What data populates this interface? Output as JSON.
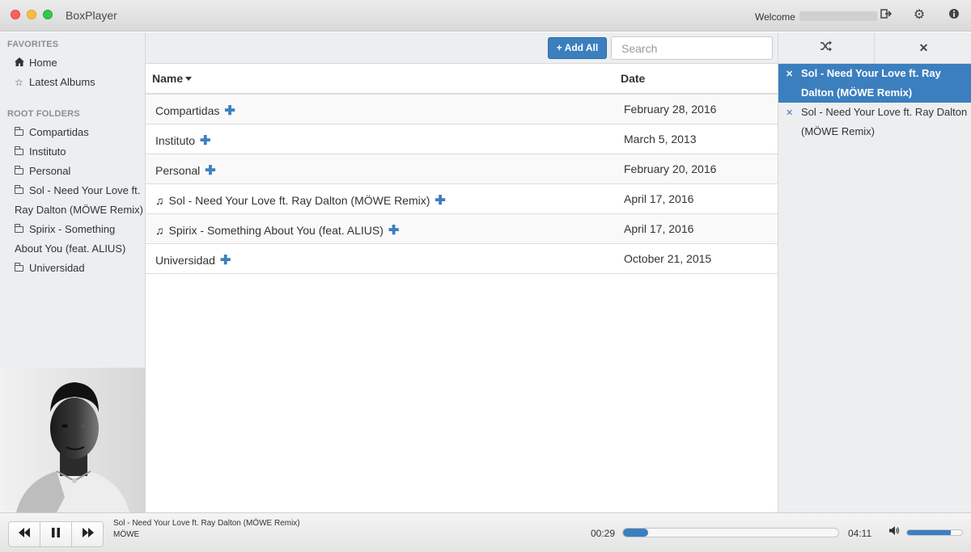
{
  "app": {
    "title": "BoxPlayer",
    "welcome": "Welcome"
  },
  "icons": {
    "logout": "logout-icon",
    "settings": "gear-icon",
    "info": "info-icon"
  },
  "sidebar": {
    "favorites_heading": "FAVORITES",
    "favorites": [
      {
        "label": "Home",
        "icon": "home-icon"
      },
      {
        "label": "Latest Albums",
        "icon": "star-icon"
      }
    ],
    "root_heading": "ROOT FOLDERS",
    "folders": [
      {
        "label": "Compartidas"
      },
      {
        "label": "Instituto"
      },
      {
        "label": "Personal"
      },
      {
        "label": "Sol - Need Your Love ft. Ray Dalton (MÖWE Remix)"
      },
      {
        "label": "Spirix - Something About You (feat. ALIUS)"
      },
      {
        "label": "Universidad"
      }
    ]
  },
  "toolbar": {
    "add_all_label": "+ Add All",
    "search_placeholder": "Search",
    "search_value": ""
  },
  "table": {
    "columns": [
      "Name",
      "Date"
    ],
    "rows": [
      {
        "name": "Compartidas",
        "date": "February 28, 2016",
        "type": "folder"
      },
      {
        "name": "Instituto",
        "date": "March 5, 2013",
        "type": "folder"
      },
      {
        "name": "Personal",
        "date": "February 20, 2016",
        "type": "folder"
      },
      {
        "name": "Sol - Need Your Love ft. Ray Dalton (MÖWE Remix)",
        "date": "April 17, 2016",
        "type": "song"
      },
      {
        "name": "Spirix - Something About You (feat. ALIUS)",
        "date": "April 17, 2016",
        "type": "song"
      },
      {
        "name": "Universidad",
        "date": "October 21, 2015",
        "type": "folder"
      }
    ]
  },
  "playlist": {
    "items": [
      {
        "title": "Sol - Need Your Love ft. Ray Dalton (MÖWE Remix)",
        "active": true
      },
      {
        "title": "Sol - Need Your Love ft. Ray Dalton (MÖWE Remix)",
        "active": false
      }
    ]
  },
  "player": {
    "title": "Sol - Need Your Love ft. Ray Dalton (MÖWE Remix)",
    "artist": "MÖWE",
    "current_time": "00:29",
    "total_time": "04:11",
    "progress": 0.115,
    "volume": 0.8
  },
  "colors": {
    "accent": "#3b7fbf",
    "sidebar_bg": "#edeef0"
  }
}
